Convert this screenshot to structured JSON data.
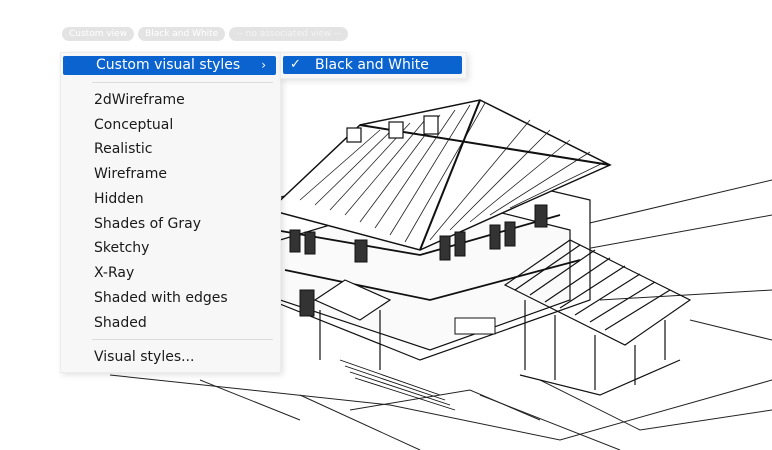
{
  "viewport_controls": [
    "Custom view",
    "Black and White",
    "-- no associated view --"
  ],
  "menu": {
    "current": {
      "label": "Custom visual styles",
      "icon": "chevron-right-icon"
    },
    "styles": [
      "2dWireframe",
      "Conceptual",
      "Realistic",
      "Wireframe",
      "Hidden",
      "Shades of Gray",
      "Sketchy",
      "X-Ray",
      "Shaded with edges",
      "Shaded"
    ],
    "footer": "Visual styles..."
  },
  "submenu": {
    "label": "Black and White",
    "checked": true,
    "icon": "checkmark-icon"
  },
  "colors": {
    "highlight": "#0a63cf",
    "menu_bg": "#f7f7f7"
  }
}
